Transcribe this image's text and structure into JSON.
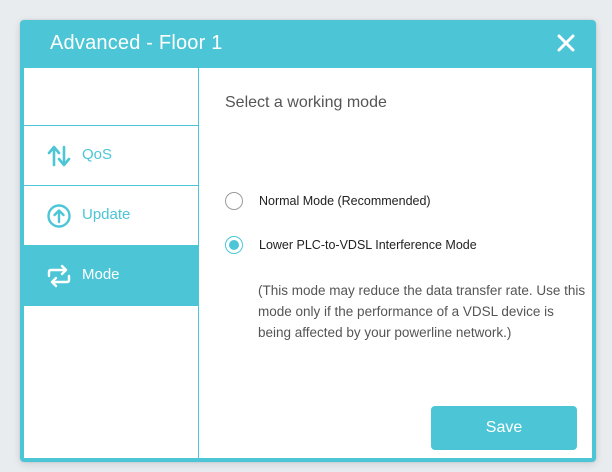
{
  "dialog": {
    "title": "Advanced - Floor 1",
    "close_icon": "close-icon"
  },
  "sidebar": {
    "items": [
      {
        "label": "QoS",
        "icon": "qos-arrows-icon",
        "active": false
      },
      {
        "label": "Update",
        "icon": "update-arrow-circle-icon",
        "active": false
      },
      {
        "label": "Mode",
        "icon": "mode-swap-icon",
        "active": true
      }
    ]
  },
  "main": {
    "section_title": "Select a working mode",
    "options": [
      {
        "label": "Normal Mode (Recommended)",
        "selected": false
      },
      {
        "label": "Lower PLC-to-VDSL Interference Mode",
        "selected": true
      }
    ],
    "note": "(This mode may reduce the data transfer rate. Use this mode only if the performance of a VDSL device is being affected by your powerline network.)",
    "save_label": "Save"
  },
  "colors": {
    "accent": "#4cc6d6",
    "text": "#555555",
    "background": "#ffffff"
  }
}
